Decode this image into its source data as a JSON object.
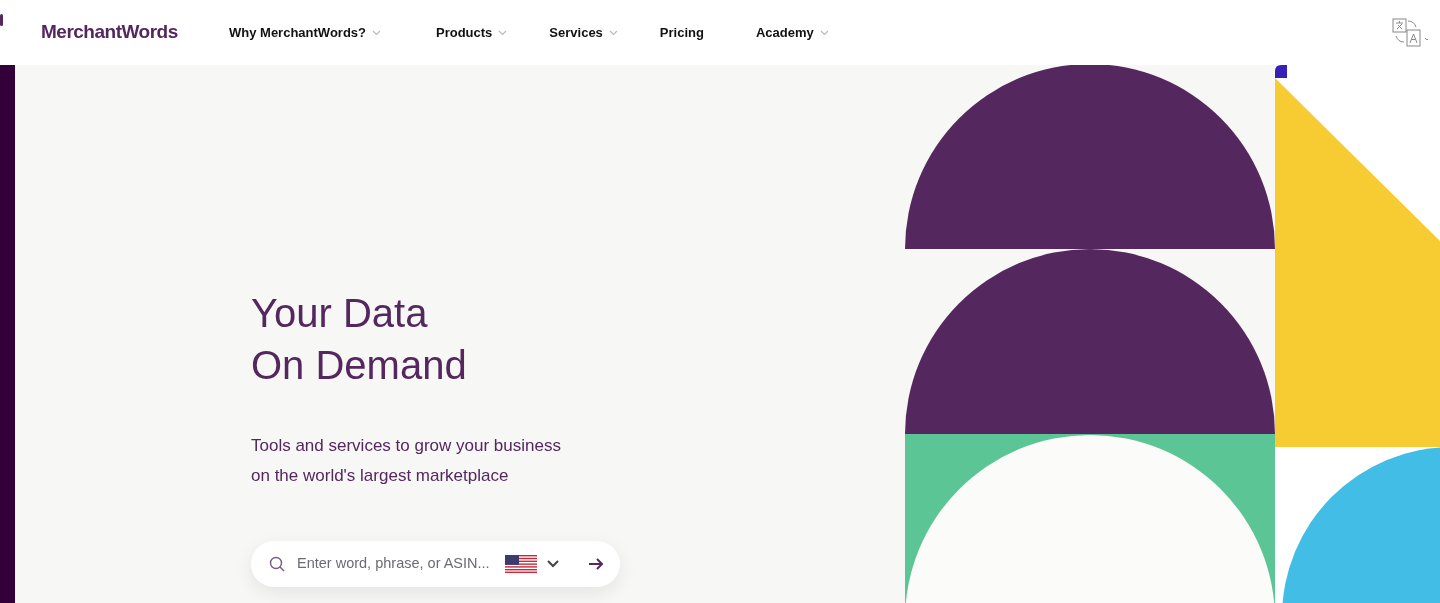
{
  "header": {
    "logo": "MerchantWords",
    "nav": [
      {
        "label": "Why MerchantWords?",
        "has_dropdown": true
      },
      {
        "label": "Products",
        "has_dropdown": true
      },
      {
        "label": "Services",
        "has_dropdown": true
      },
      {
        "label": "Pricing",
        "has_dropdown": false
      },
      {
        "label": "Academy",
        "has_dropdown": true
      }
    ]
  },
  "hero": {
    "title_lines": [
      "Your Data",
      "On Demand"
    ],
    "subtitle_lines": [
      "Tools and services to grow your business",
      "on the world's largest marketplace"
    ],
    "search": {
      "placeholder": "Enter word, phrase, or ASIN..."
    }
  }
}
